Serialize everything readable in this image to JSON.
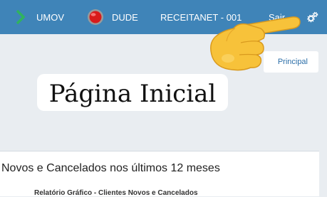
{
  "topbar": {
    "items": [
      {
        "label": "UMOV",
        "icon": "chevron-right-icon"
      },
      {
        "label": "DUDE",
        "icon": "red-record-icon"
      },
      {
        "label": "RECEITANET - 001",
        "icon": ""
      },
      {
        "label": "Sair",
        "icon": ""
      }
    ],
    "settings_icon": "cogs-icon"
  },
  "breadcrumb": {
    "label": "Principal"
  },
  "page": {
    "title": "Página Inicial"
  },
  "panel": {
    "title": "Novos e Cancelados nos últimos 12 meses",
    "chart_title": "Relatório Gráfico - Clientes Novos e Cancelados"
  },
  "colors": {
    "topbar": "#3f84b8",
    "accent_green": "#2fb35e",
    "record_red": "#d81b1b",
    "emoji_yellow": "#f7c23a"
  }
}
